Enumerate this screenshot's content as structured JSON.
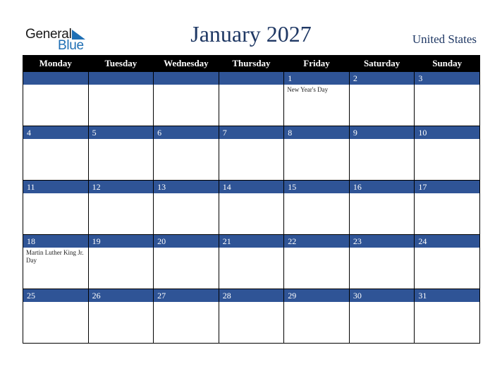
{
  "logo": {
    "word1": "General",
    "word2": "Blue",
    "accent": "#1f6fb4"
  },
  "title": "January 2027",
  "country": "United States",
  "colors": {
    "header_bg": "#000000",
    "daybar_bg": "#2f5496",
    "title": "#1f3864"
  },
  "weekdays": [
    "Monday",
    "Tuesday",
    "Wednesday",
    "Thursday",
    "Friday",
    "Saturday",
    "Sunday"
  ],
  "weeks": [
    [
      {
        "day": "",
        "holiday": ""
      },
      {
        "day": "",
        "holiday": ""
      },
      {
        "day": "",
        "holiday": ""
      },
      {
        "day": "",
        "holiday": ""
      },
      {
        "day": "1",
        "holiday": "New Year's Day"
      },
      {
        "day": "2",
        "holiday": ""
      },
      {
        "day": "3",
        "holiday": ""
      }
    ],
    [
      {
        "day": "4",
        "holiday": ""
      },
      {
        "day": "5",
        "holiday": ""
      },
      {
        "day": "6",
        "holiday": ""
      },
      {
        "day": "7",
        "holiday": ""
      },
      {
        "day": "8",
        "holiday": ""
      },
      {
        "day": "9",
        "holiday": ""
      },
      {
        "day": "10",
        "holiday": ""
      }
    ],
    [
      {
        "day": "11",
        "holiday": ""
      },
      {
        "day": "12",
        "holiday": ""
      },
      {
        "day": "13",
        "holiday": ""
      },
      {
        "day": "14",
        "holiday": ""
      },
      {
        "day": "15",
        "holiday": ""
      },
      {
        "day": "16",
        "holiday": ""
      },
      {
        "day": "17",
        "holiday": ""
      }
    ],
    [
      {
        "day": "18",
        "holiday": "Martin Luther King Jr. Day"
      },
      {
        "day": "19",
        "holiday": ""
      },
      {
        "day": "20",
        "holiday": ""
      },
      {
        "day": "21",
        "holiday": ""
      },
      {
        "day": "22",
        "holiday": ""
      },
      {
        "day": "23",
        "holiday": ""
      },
      {
        "day": "24",
        "holiday": ""
      }
    ],
    [
      {
        "day": "25",
        "holiday": ""
      },
      {
        "day": "26",
        "holiday": ""
      },
      {
        "day": "27",
        "holiday": ""
      },
      {
        "day": "28",
        "holiday": ""
      },
      {
        "day": "29",
        "holiday": ""
      },
      {
        "day": "30",
        "holiday": ""
      },
      {
        "day": "31",
        "holiday": ""
      }
    ]
  ]
}
